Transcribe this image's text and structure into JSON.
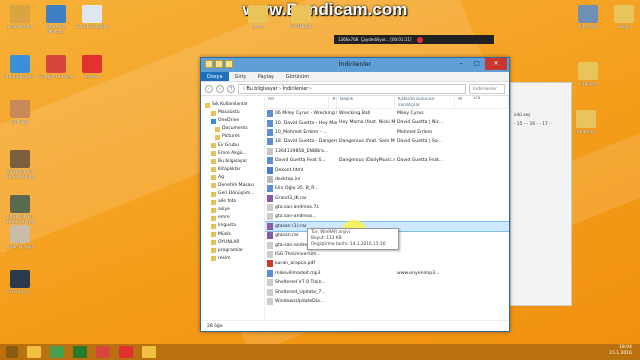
{
  "watermark": "www.Bandicam.com",
  "recorder": {
    "resolution": "1366x768",
    "status": "Çaydediliyor...",
    "time": "[00:01:11]"
  },
  "desktop_left": [
    {
      "label": "programlar",
      "color": "#d9a441"
    },
    {
      "label": "Denetim Masası",
      "color": "#3f7fc4"
    },
    {
      "label": "Geri Dönüşüm",
      "color": "#dfe7ef"
    },
    {
      "label": "Bu bilgisayar",
      "color": "#3a8fd8"
    },
    {
      "label": "Google Chrome",
      "color": "#d8453a"
    },
    {
      "label": "Yandex",
      "color": "#e33030"
    },
    {
      "label": "indir.jpg",
      "color": "#c98a5a"
    },
    {
      "label": "2016-01-14 18.30.20.jpg",
      "color": "#7a6040"
    },
    {
      "label": "2016-01-14 18.30.20.jpg",
      "color": "#5a6a50"
    },
    {
      "label": "indir (1).jpg",
      "color": "#c9bda9"
    },
    {
      "label": "ATG-türk...",
      "color": "#2b3a4a"
    }
  ],
  "desktop_top": [
    {
      "label": "emre"
    },
    {
      "label": "OYUNLAR"
    }
  ],
  "desktop_right": [
    {
      "label": "aile foto"
    },
    {
      "label": "asiye"
    },
    {
      "label": "lingusta"
    },
    {
      "label": "Belgeler"
    }
  ],
  "window": {
    "title": "İndirilenler",
    "ribbon_tabs": [
      "Dosya",
      "Giriş",
      "Paylaş",
      "Görünüm"
    ],
    "path": "› Bu bilgisayar › İndirilenler ›",
    "search_placeholder": "İndirilenler ara",
    "nav_items": [
      "Sık Kullanılanlar",
      "Masaüstü",
      "OneDrive",
      "Documents",
      "Pictures",
      "Ev Grubu",
      "Emre Akgü...",
      "Bu bilgisayar",
      "Kitaplıklar",
      "Ağ",
      "Denetim Masası",
      "Geri Dönüşüm...",
      "aile foto",
      "asiye",
      "emre",
      "lingusta",
      "Müzik",
      "OYUNLAR",
      "programlar",
      "resim"
    ],
    "columns": [
      "Ad",
      "#",
      "Başlık",
      "Katkıda bulunan sanatçılar",
      "Al"
    ],
    "files": [
      {
        "name": "06 Miley Cyrus - Wrecking Ball",
        "title": "Wrecking Ball",
        "artist": "Miley Cyrus",
        "album": "",
        "icon": "#5f8fd0"
      },
      {
        "name": "10. David Guetta - Hey Mama",
        "title": "Hey Mama (feat. Nicki Minaj...",
        "artist": "David Guetta | Nic...",
        "album": "",
        "icon": "#5f8fd0"
      },
      {
        "name": "10_Mehmet Erdem - ...",
        "title": "",
        "artist": "Mehmet Erdem",
        "album": "",
        "icon": "#5f8fd0"
      },
      {
        "name": "18. David Guetta - Dangerous",
        "title": "Dangerous (feat. Sam Martin)",
        "artist": "David Guetta | Sa...",
        "album": "",
        "icon": "#5f8fd0"
      },
      {
        "name": "1364119858_ENBBra...",
        "title": "",
        "artist": "",
        "album": "",
        "icon": "#c5c5c5"
      },
      {
        "name": "David Guetta Feat S...",
        "title": "Dangerous (DailyMusic.ru...",
        "artist": "David Guetta Feat...",
        "album": "",
        "icon": "#5f8fd0"
      },
      {
        "name": "Dekont.html",
        "title": "",
        "artist": "",
        "album": "",
        "icon": "#4a7bd0"
      },
      {
        "name": "desktop.ini",
        "title": "",
        "artist": "",
        "album": "",
        "icon": "#bbbbbb"
      },
      {
        "name": "Elin Oğlu 35. B_R...",
        "title": "",
        "artist": "",
        "album": "",
        "icon": "#5f8fd0"
      },
      {
        "name": "Grand3_IK.rar",
        "title": "",
        "artist": "",
        "album": "",
        "icon": "#8a5aa8"
      },
      {
        "name": "gta.san.andreas.7z",
        "title": "",
        "artist": "",
        "album": "",
        "icon": "#cccccc"
      },
      {
        "name": "gta.san-andreas...",
        "title": "",
        "artist": "",
        "album": "",
        "icon": "#cccccc"
      },
      {
        "name": "gtasan (1).rar",
        "title": "",
        "artist": "",
        "album": "",
        "icon": "#8a5aa8"
      },
      {
        "name": "gtasan.rar",
        "title": "",
        "artist": "",
        "album": "",
        "icon": "#8a5aa8"
      },
      {
        "name": "gta-san-andreas...",
        "title": "",
        "artist": "",
        "album": "",
        "icon": "#cccccc"
      },
      {
        "name": "IGG-TheUniversim...",
        "title": "",
        "artist": "",
        "album": "",
        "icon": "#cccccc"
      },
      {
        "name": "kuran_arapca.pdf",
        "title": "",
        "artist": "",
        "album": "",
        "icon": "#d03a2a"
      },
      {
        "name": "mikevillmadeit.mp3",
        "title": "",
        "artist": "www.enyenimp3...",
        "album": "",
        "icon": "#5f8fd0"
      },
      {
        "name": "Sheltered V7.0 Train...",
        "title": "",
        "artist": "",
        "album": "",
        "icon": "#cccccc"
      },
      {
        "name": "Sheltered_Update_7...",
        "title": "",
        "artist": "",
        "album": "",
        "icon": "#cccccc"
      },
      {
        "name": "WindowsUpdateDia...",
        "title": "",
        "artist": "",
        "album": "",
        "icon": "#cccccc"
      }
    ],
    "tooltip": {
      "type": "Tür: WinRAR arşivi",
      "size": "Boyut: 113 KB",
      "date": "Değiştirme tarihi: 14.1.2016 15:16"
    },
    "status": "28 öğe"
  },
  "right_panel": {
    "label": "inlü seç",
    "row": "- 15 - - 16 - - 17 -"
  },
  "clock": {
    "time": "18:04",
    "date": "15.1.2016"
  },
  "taskbar_apps": [
    {
      "name": "explorer",
      "color": "#f0c040"
    },
    {
      "name": "calculator",
      "color": "#4aa050"
    },
    {
      "name": "store",
      "color": "#2a7a2a"
    },
    {
      "name": "chrome",
      "color": "#d8453a"
    },
    {
      "name": "yandex",
      "color": "#e33030"
    },
    {
      "name": "explorer-active",
      "color": "#f0c040"
    }
  ]
}
